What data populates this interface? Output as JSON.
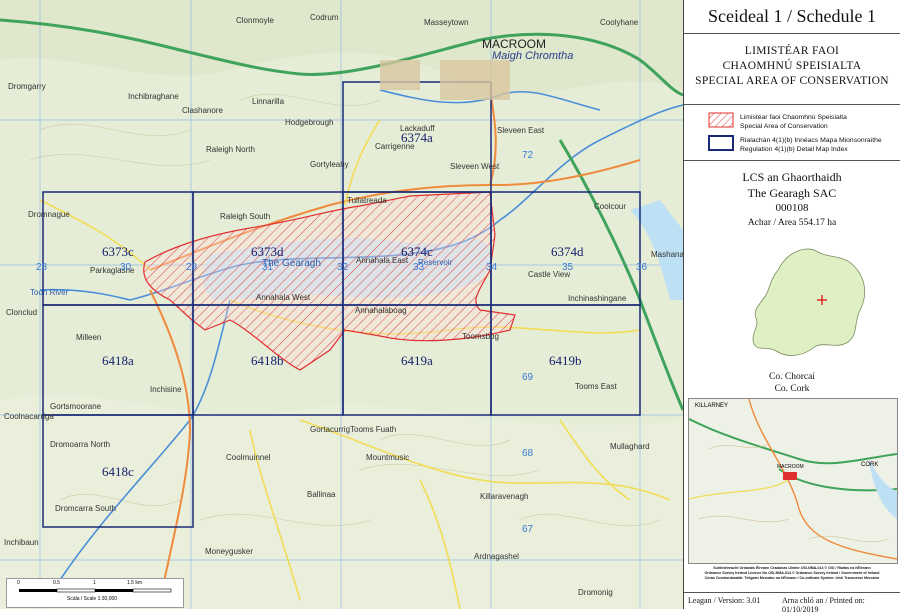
{
  "header": {
    "title": "Sceideal 1 / Schedule 1",
    "sac_type_ga_1": "LIMISTÉAR FAOI",
    "sac_type_ga_2": "CHAOMHNÚ SPEISIALTA",
    "sac_type_en": "SPECIAL AREA OF CONSERVATION"
  },
  "legend": {
    "sac_label_ga": "Limistéar faoi Chaomhnú Speisialta",
    "sac_label_en": "Special Area of Conservation",
    "index_label_ga": "Rialachán 4(1)(b) Innéacs Mapa Mionsonraithe",
    "index_label_en": "Regulation 4(1)(b) Detail Map Index",
    "sac_color": "#e03030",
    "index_color": "#1a2a78"
  },
  "site": {
    "name_ga": "LCS an Ghaorthaidh",
    "name_en": "The Gearagh SAC",
    "code": "000108",
    "area": "Achar / Area 554.17 ha",
    "county_ga": "Co. Chorcaí",
    "county_en": "Co. Cork"
  },
  "map": {
    "tiles": [
      "6374a",
      "6373c",
      "6373d",
      "6374c",
      "6374d",
      "6418a",
      "6418b",
      "6419a",
      "6419b",
      "6418c"
    ],
    "places": {
      "macroom": "MACROOM",
      "macroom_ga": "Maigh Chromtha",
      "gearagh": "The Gearagh",
      "toon_river": "Toon River",
      "reservoir": "Reservoir",
      "massytown": "Masseytown",
      "codrum": "Codrum",
      "coolyhane": "Coolyhane",
      "clonmoyle": "Clonmoyle",
      "dromgarry": "Dromgarry",
      "inchibraghane": "Inchibraghane",
      "clashanore": "Clashanore",
      "rialeigh_north": "Raleigh North",
      "raleigh_south": "Raleigh South",
      "hodgebrough": "Hodgebrough",
      "gortyleahy": "Gortyleahy",
      "carrigenne": "Carrigenne",
      "slevoen_east": "Sleveen East",
      "sleveen_west": "Sleveen West",
      "lackaduff": "Lackaduff",
      "linnarilla": "Linnarilla",
      "dromnague": "Dromnague",
      "parkaglashe": "Parkaglashe",
      "annahala_east": "Annahala East",
      "annahala_west": "Annahala West",
      "annahalaboag": "Annahalaboag",
      "toomsbog": "Toomsbog",
      "tooms_east": "Tooms East",
      "inchinashingane": "Inchinashingane",
      "castle_view": "Castle View",
      "coolcour": "Coolcour",
      "mashanaglass": "Mashanaglass",
      "clonclud": "Clonclud",
      "milleen": "Milleen",
      "inchisine": "Inchisine",
      "gortsmoorane": "Gortsmoorane",
      "dromoarra_north": "Dromoarra North",
      "dromcarra_south": "Dromcarra South",
      "coolnacarriga": "Coolnacarriga",
      "coolmuinnel": "Coolmuinnel",
      "mountmusic": "Mountmusic",
      "gortacurrig": "Gortacurrig",
      "ballinaa": "Ballinaa",
      "killaravenagh": "Killaravenagh",
      "ardnagashel": "Ardnagashel",
      "mullaghard": "Mullaghard",
      "moneygusker": "Moneygusker",
      "dromonig": "Dromonig",
      "inchibaun": "Inchibaun",
      "illaun": "Tullatreada",
      "tooms_fuath": "Tooms Fuath"
    },
    "grid_numbers": [
      "28",
      "29",
      "30",
      "31",
      "32",
      "33",
      "34",
      "35",
      "36",
      "72",
      "69",
      "68",
      "67"
    ]
  },
  "location_map": {
    "killarney": "KILLARNEY",
    "cork": "CORK",
    "macroom": "MACROOM"
  },
  "scalebar": {
    "ticks": [
      "0",
      "0.5",
      "1",
      "1.5 km"
    ],
    "label": "Scála / Scale 1:30,000"
  },
  "fine_print": [
    "Suirbhéireacht Ordanáis Éireann Ceadúnas Uimhir OSi-NMA-014 © OSi / Rialtas na hÉireann",
    "Ordnance Survey Ireland Licence No OSi-NMA-014 © Ordnance Survey Ireland / Government of Ireland",
    "Córas Comhordanáidí: Teilgean Mercator na hÉireann / Co-ordinate System: Irish Transverse Mercator"
  ],
  "footer": {
    "version": "Leagan / Version: 3.01",
    "printed": "Arna chló an / Printed on: 01/10/2019"
  }
}
